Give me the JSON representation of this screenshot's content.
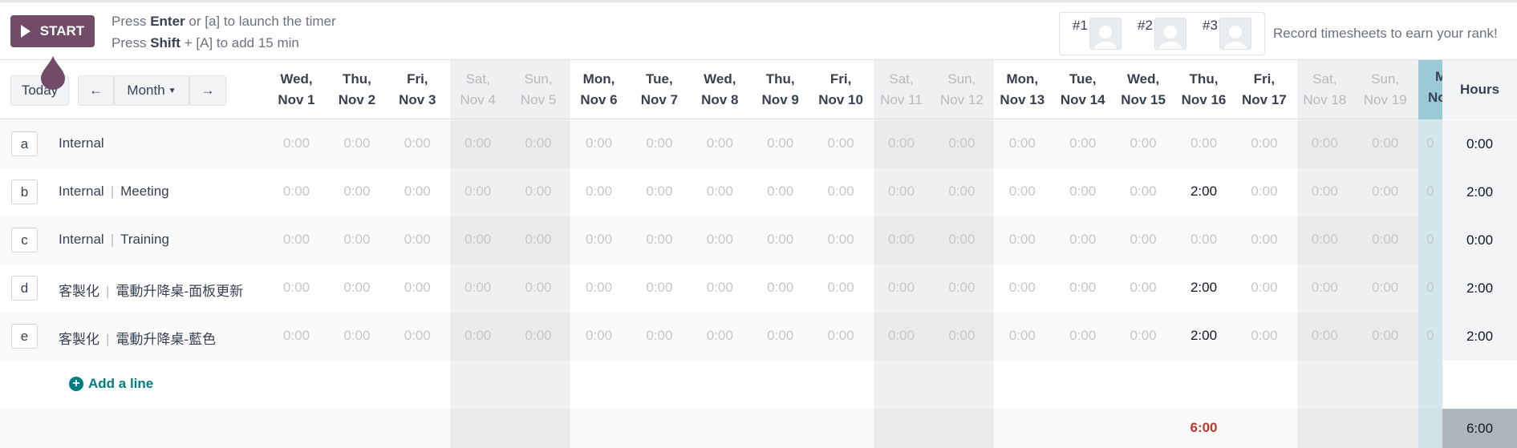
{
  "toolbar": {
    "start_label": "START",
    "hint_line1_pre": "Press ",
    "hint_line1_key": "Enter",
    "hint_line1_post": " or [a] to launch the timer",
    "hint_line2_pre": "Press ",
    "hint_line2_key": "Shift",
    "hint_line2_post": " + [A] to add 15 min",
    "ranks": [
      {
        "label": "#1"
      },
      {
        "label": "#2"
      },
      {
        "label": "#3"
      }
    ],
    "rank_text": "Record timesheets to earn your rank!"
  },
  "nav": {
    "today_label": "Today",
    "prev_icon": "arrow-left-icon",
    "period_label": "Month",
    "next_icon": "arrow-right-icon"
  },
  "days": [
    {
      "dow": "Wed,",
      "date": "Nov 1",
      "weekend": false
    },
    {
      "dow": "Thu,",
      "date": "Nov 2",
      "weekend": false
    },
    {
      "dow": "Fri,",
      "date": "Nov 3",
      "weekend": false
    },
    {
      "dow": "Sat,",
      "date": "Nov 4",
      "weekend": true
    },
    {
      "dow": "Sun,",
      "date": "Nov 5",
      "weekend": true
    },
    {
      "dow": "Mon,",
      "date": "Nov 6",
      "weekend": false
    },
    {
      "dow": "Tue,",
      "date": "Nov 7",
      "weekend": false
    },
    {
      "dow": "Wed,",
      "date": "Nov 8",
      "weekend": false
    },
    {
      "dow": "Thu,",
      "date": "Nov 9",
      "weekend": false
    },
    {
      "dow": "Fri,",
      "date": "Nov 10",
      "weekend": false
    },
    {
      "dow": "Sat,",
      "date": "Nov 11",
      "weekend": true
    },
    {
      "dow": "Sun,",
      "date": "Nov 12",
      "weekend": true
    },
    {
      "dow": "Mon,",
      "date": "Nov 13",
      "weekend": false
    },
    {
      "dow": "Tue,",
      "date": "Nov 14",
      "weekend": false
    },
    {
      "dow": "Wed,",
      "date": "Nov 15",
      "weekend": false
    },
    {
      "dow": "Thu,",
      "date": "Nov 16",
      "weekend": false
    },
    {
      "dow": "Fri,",
      "date": "Nov 17",
      "weekend": false
    },
    {
      "dow": "Sat,",
      "date": "Nov 18",
      "weekend": true
    },
    {
      "dow": "Sun,",
      "date": "Nov 19",
      "weekend": true
    }
  ],
  "today_header": {
    "dow": "M",
    "date": "No"
  },
  "hours_header": "Hours",
  "rows": [
    {
      "key": "a",
      "project": "Internal",
      "task": "",
      "values": [
        "0:00",
        "0:00",
        "0:00",
        "0:00",
        "0:00",
        "0:00",
        "0:00",
        "0:00",
        "0:00",
        "0:00",
        "0:00",
        "0:00",
        "0:00",
        "0:00",
        "0:00",
        "0:00",
        "0:00",
        "0:00",
        "0:00"
      ],
      "today": "0",
      "total": "0:00"
    },
    {
      "key": "b",
      "project": "Internal",
      "task": "Meeting",
      "values": [
        "0:00",
        "0:00",
        "0:00",
        "0:00",
        "0:00",
        "0:00",
        "0:00",
        "0:00",
        "0:00",
        "0:00",
        "0:00",
        "0:00",
        "0:00",
        "0:00",
        "0:00",
        "2:00",
        "0:00",
        "0:00",
        "0:00"
      ],
      "today": "0",
      "total": "2:00"
    },
    {
      "key": "c",
      "project": "Internal",
      "task": "Training",
      "values": [
        "0:00",
        "0:00",
        "0:00",
        "0:00",
        "0:00",
        "0:00",
        "0:00",
        "0:00",
        "0:00",
        "0:00",
        "0:00",
        "0:00",
        "0:00",
        "0:00",
        "0:00",
        "0:00",
        "0:00",
        "0:00",
        "0:00"
      ],
      "today": "0",
      "total": "0:00"
    },
    {
      "key": "d",
      "project": "客製化",
      "task": "電動升降桌-面板更新",
      "values": [
        "0:00",
        "0:00",
        "0:00",
        "0:00",
        "0:00",
        "0:00",
        "0:00",
        "0:00",
        "0:00",
        "0:00",
        "0:00",
        "0:00",
        "0:00",
        "0:00",
        "0:00",
        "2:00",
        "0:00",
        "0:00",
        "0:00"
      ],
      "today": "0",
      "total": "2:00"
    },
    {
      "key": "e",
      "project": "客製化",
      "task": "電動升降桌-藍色",
      "values": [
        "0:00",
        "0:00",
        "0:00",
        "0:00",
        "0:00",
        "0:00",
        "0:00",
        "0:00",
        "0:00",
        "0:00",
        "0:00",
        "0:00",
        "0:00",
        "0:00",
        "0:00",
        "2:00",
        "0:00",
        "0:00",
        "0:00"
      ],
      "today": "0",
      "total": "2:00"
    }
  ],
  "add_line_label": "Add a line",
  "day_totals": [
    "",
    "",
    "",
    "",
    "",
    "",
    "",
    "",
    "",
    "",
    "",
    "",
    "",
    "",
    "",
    "6:00",
    "",
    "",
    ""
  ],
  "grand_total": "6:00"
}
